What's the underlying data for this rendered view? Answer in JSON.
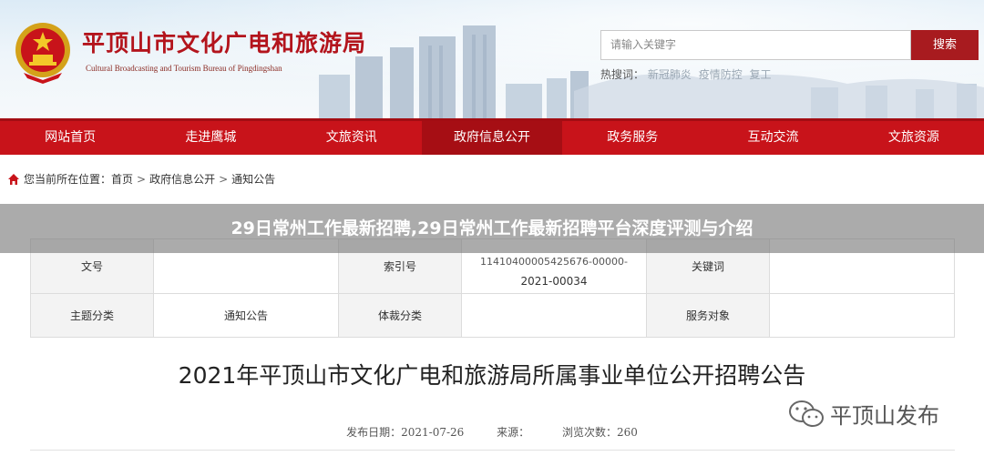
{
  "header": {
    "site_title": "平顶山市文化广电和旅游局",
    "site_subtitle": "Cultural Broadcasting and Tourism Bureau of Pingdingshan",
    "search_placeholder": "请输入关键字",
    "search_button": "搜索",
    "hot_label": "热搜词：",
    "hot_words": [
      "新冠肺炎",
      "疫情防控",
      "复工"
    ]
  },
  "nav": {
    "items": [
      "网站首页",
      "走进鹰城",
      "文旅资讯",
      "政府信息公开",
      "政务服务",
      "互动交流",
      "文旅资源"
    ],
    "active_index": 3
  },
  "breadcrumb": {
    "prefix": "您当前所在位置：",
    "items": [
      "首页",
      "政府信息公开",
      "通知公告"
    ],
    "separator": ">"
  },
  "overlay_title": "29日常州工作最新招聘,29日常州工作最新招聘平台深度评测与介绍",
  "meta_table": {
    "wenhao_label": "文号",
    "wenhao_value": "",
    "suoyin_label": "索引号",
    "suoyin_code": "11410400005425676-00000-",
    "suoyin_value": "2021-00034",
    "keyword_label": "关键词",
    "keyword_value": "",
    "topic_label": "主题分类",
    "topic_value": "通知公告",
    "genre_label": "体裁分类",
    "genre_value": "",
    "audience_label": "服务对象",
    "audience_value": ""
  },
  "article": {
    "title": "2021年平顶山市文化广电和旅游局所属事业单位公开招聘公告",
    "publish_date": "发布日期：2021-07-26",
    "source": "来源：",
    "views": "浏览次数：260"
  },
  "watermark": {
    "text": "平顶山发布"
  },
  "colors": {
    "brand_red": "#c8131a",
    "nav_active": "#a60e14",
    "search_button": "#a81b1f",
    "title_red": "#b3141c"
  }
}
